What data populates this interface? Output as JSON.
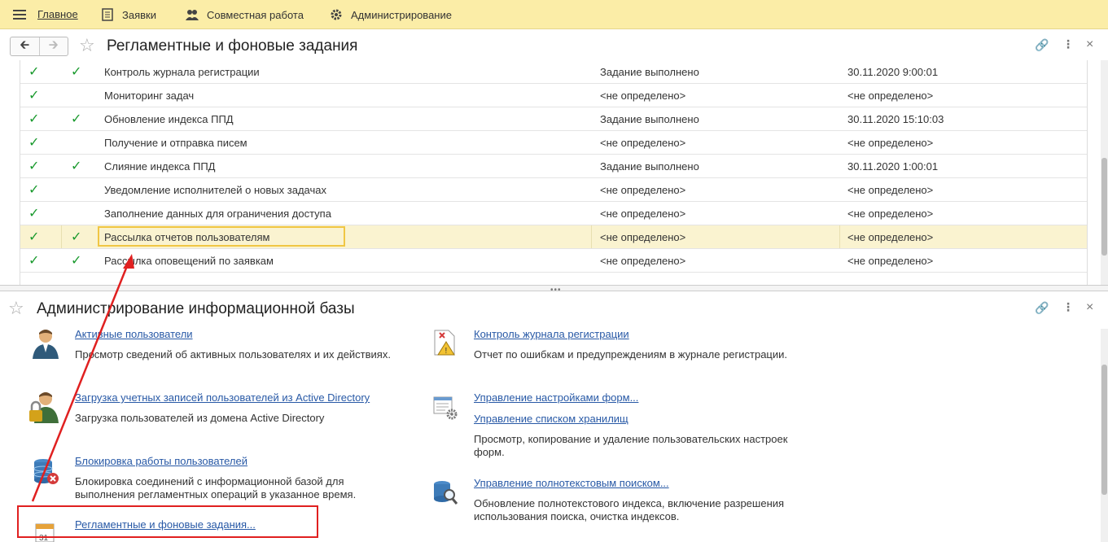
{
  "topbar": {
    "items": [
      {
        "label": "Главное"
      },
      {
        "label": "Заявки"
      },
      {
        "label": "Совместная работа"
      },
      {
        "label": "Администрирование"
      }
    ]
  },
  "window1": {
    "title": "Регламентные и фоновые задания",
    "rows": [
      {
        "check1": "✓",
        "check2": "✓",
        "name": "Контроль журнала регистрации",
        "state": "Задание выполнено",
        "date": "30.11.2020 9:00:01"
      },
      {
        "check1": "✓",
        "check2": "",
        "name": "Мониторинг задач",
        "state": "<не определено>",
        "date": "<не определено>"
      },
      {
        "check1": "✓",
        "check2": "✓",
        "name": "Обновление индекса ППД",
        "state": "Задание выполнено",
        "date": "30.11.2020 15:10:03"
      },
      {
        "check1": "✓",
        "check2": "",
        "name": "Получение и отправка писем",
        "state": "<не определено>",
        "date": "<не определено>"
      },
      {
        "check1": "✓",
        "check2": "✓",
        "name": "Слияние индекса ППД",
        "state": "Задание выполнено",
        "date": "30.11.2020 1:00:01"
      },
      {
        "check1": "✓",
        "check2": "",
        "name": "Уведомление исполнителей о новых задачах",
        "state": "<не определено>",
        "date": "<не определено>"
      },
      {
        "check1": "✓",
        "check2": "",
        "name": "Заполнение данных для ограничения доступа",
        "state": "<не определено>",
        "date": "<не определено>"
      },
      {
        "check1": "✓",
        "check2": "✓",
        "name": "Рассылка отчетов пользователям",
        "state": "<не определено>",
        "date": "<не определено>",
        "selected": true
      },
      {
        "check1": "✓",
        "check2": "✓",
        "name": "Рассылка оповещений по заявкам",
        "state": "<не определено>",
        "date": "<не определено>"
      }
    ]
  },
  "window2": {
    "title": "Администрирование информационной базы",
    "left": [
      {
        "link": "Активные пользователи",
        "desc": "Просмотр сведений об активных пользователях и их действиях."
      },
      {
        "link": "Загрузка учетных записей пользователей из Active Directory",
        "desc": "Загрузка пользователей из домена Active Directory"
      },
      {
        "link": "Блокировка работы пользователей",
        "desc1": "Блокировка соединений с информационной базой для",
        "desc2": "выполнения регламентных операций в указанное время."
      },
      {
        "link": "Регламентные и фоновые задания..."
      }
    ],
    "right": [
      {
        "link": "Контроль журнала регистрации",
        "desc": "Отчет по ошибкам и предупреждениям в журнале регистрации."
      },
      {
        "link": "Управление настройками форм...",
        "link2": "Управление списком хранилищ",
        "desc1": "Просмотр, копирование и удаление пользовательских настроек",
        "desc2": "форм."
      },
      {
        "link": "Управление полнотекстовым поиском...",
        "desc1": "Обновление полнотекстового индекса, включение разрешения",
        "desc2": "использования поиска, очистка индексов."
      }
    ],
    "calendar_day": "31"
  },
  "colors": {
    "topbar": "#fbeda7",
    "check": "#1a9a2e",
    "link": "#2859a6",
    "highlight": "#e02020",
    "selected_row": "#faf3d0"
  }
}
